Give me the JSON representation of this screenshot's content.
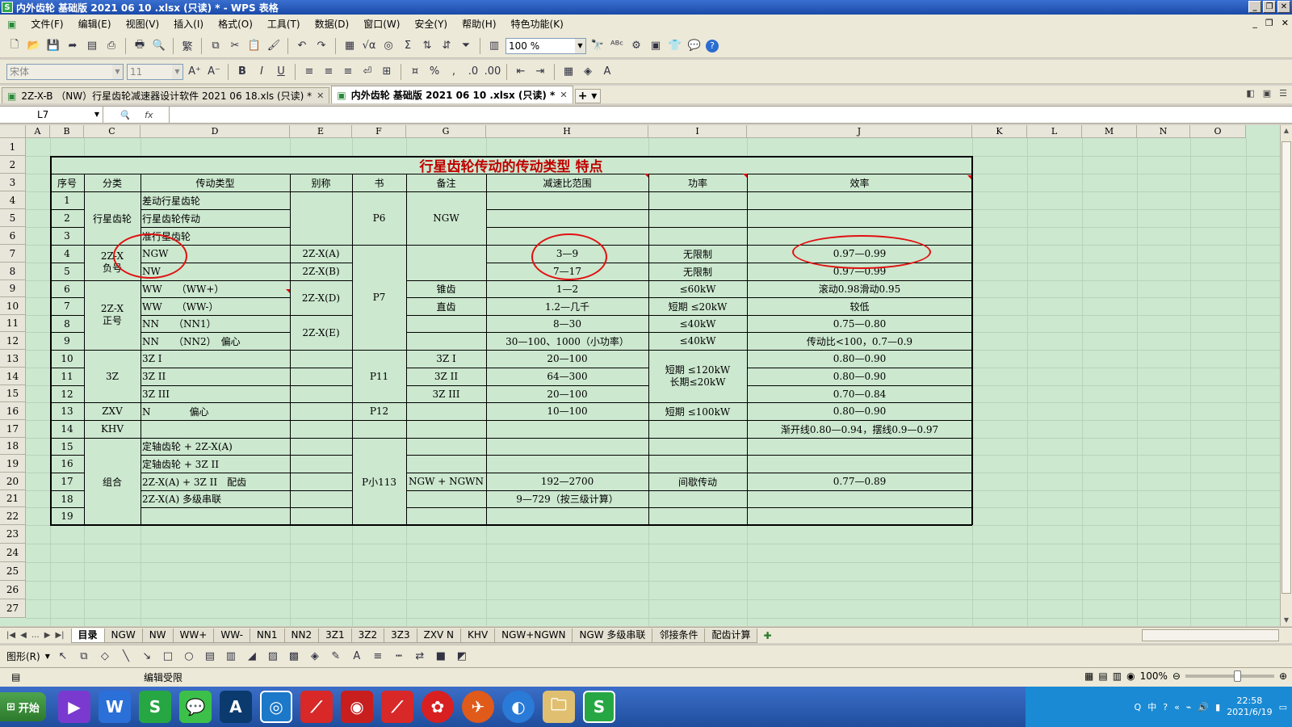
{
  "window": {
    "title": "内外齿轮 基础版 2021 06 10 .xlsx (只读) * - WPS 表格",
    "app_icon": "S"
  },
  "menu": [
    "文件(F)",
    "编辑(E)",
    "视图(V)",
    "插入(I)",
    "格式(O)",
    "工具(T)",
    "数据(D)",
    "窗口(W)",
    "安全(Y)",
    "帮助(H)",
    "特色功能(K)"
  ],
  "toolbar": {
    "zoom": "100 %",
    "font_name": "宋体",
    "font_size": "11",
    "pct": "%"
  },
  "doc_tabs": [
    {
      "label": "2Z-X-B （NW）行星齿轮减速器设计软件 2021 06 18.xls (只读) *"
    },
    {
      "label": "内外齿轮 基础版 2021 06 10 .xlsx (只读) *"
    }
  ],
  "formula_bar": {
    "cell_ref": "L7",
    "fx": "fx",
    "content": ""
  },
  "columns": [
    "A",
    "B",
    "C",
    "D",
    "E",
    "F",
    "G",
    "H",
    "I",
    "J",
    "K",
    "L",
    "M",
    "N",
    "O"
  ],
  "rows": [
    "1",
    "2",
    "3",
    "4",
    "5",
    "6",
    "7",
    "8",
    "9",
    "10",
    "11",
    "12",
    "13",
    "14",
    "15",
    "16",
    "17",
    "18",
    "19",
    "20",
    "21",
    "22",
    "23",
    "24",
    "25",
    "26",
    "27"
  ],
  "sheet": {
    "title": "行星齿轮传动的传动类型 特点",
    "headers": [
      "序号",
      "分类",
      "传动类型",
      "别称",
      "书",
      "备注",
      "减速比范围",
      "功率",
      "效率"
    ],
    "seq": [
      "1",
      "2",
      "3",
      "4",
      "5",
      "6",
      "7",
      "8",
      "9",
      "10",
      "11",
      "12",
      "13",
      "14",
      "15",
      "16",
      "17",
      "18",
      "19"
    ],
    "cat": [
      "行星齿轮",
      "2Z-X\n负号",
      "2Z-X\n正号",
      "3Z",
      "ZXV",
      "KHV",
      "组合"
    ],
    "type": [
      "差动行星齿轮",
      "行星齿轮传动",
      "准行星齿轮",
      "NGW",
      "NW",
      "WW　　（WW+）",
      "WW　　（WW-）",
      "NN　　（NN1）",
      "NN　　（NN2）　偏心",
      "3Z I",
      "3Z II",
      "3Z III",
      "N　　　　偏心",
      "",
      "定轴齿轮 + 2Z-X(A)",
      "定轴齿轮 + 3Z II",
      "2Z-X(A) + 3Z II　配齿",
      "2Z-X(A) 多级串联",
      ""
    ],
    "alias": [
      "2Z-X(A)",
      "2Z-X(B)",
      "2Z-X(D)",
      "2Z-X(E)"
    ],
    "book": [
      "P6",
      "P7",
      "P11",
      "P12",
      "P小113"
    ],
    "note": [
      "NGW",
      "锥齿",
      "直齿",
      "3Z I",
      "3Z II",
      "3Z III",
      "NGW + NGWN"
    ],
    "ratio": [
      "3—9",
      "7—17",
      "1—2",
      "1.2—几千",
      "8—30",
      "30—100、1000（小功率）",
      "20—100",
      "64—300",
      "20—100",
      "10—100",
      "192—2700",
      "9—729（按三级计算）"
    ],
    "power": [
      "无限制",
      "无限制",
      "≤60kW",
      "短期 ≤20kW",
      "≤40kW",
      "≤40kW",
      "短期 ≤120kW\n长期≤20kW",
      "短期 ≤100kW",
      "间歇传动"
    ],
    "eff": [
      "0.97—0.99",
      "0.97—0.99",
      "滚动0.98滑动0.95",
      "较低",
      "0.75—0.80",
      "传动比<100，0.7—0.9",
      "0.80—0.90",
      "0.80—0.90",
      "0.70—0.84",
      "0.80—0.90",
      "渐开线0.80—0.94，摆线0.9—0.97",
      "0.77—0.89"
    ]
  },
  "sheet_tabs": [
    "目录",
    "NGW",
    "NW",
    "WW+",
    "WW-",
    "NN1",
    "NN2",
    "3Z1",
    "3Z2",
    "3Z3",
    "ZXV N",
    "KHV",
    "NGW+NGWN",
    "NGW 多级串联",
    "邻接条件",
    "配齿计算"
  ],
  "drawbar": {
    "label": "图形(R)"
  },
  "status": {
    "text": "编辑受限",
    "zoom": "100%"
  },
  "taskbar": {
    "start": "开始",
    "time": "22:58",
    "date": "2021/6/19"
  },
  "colors": {
    "title_red": "#c00000",
    "grid_bg": "#cce8cf",
    "circle": "#e01010"
  }
}
